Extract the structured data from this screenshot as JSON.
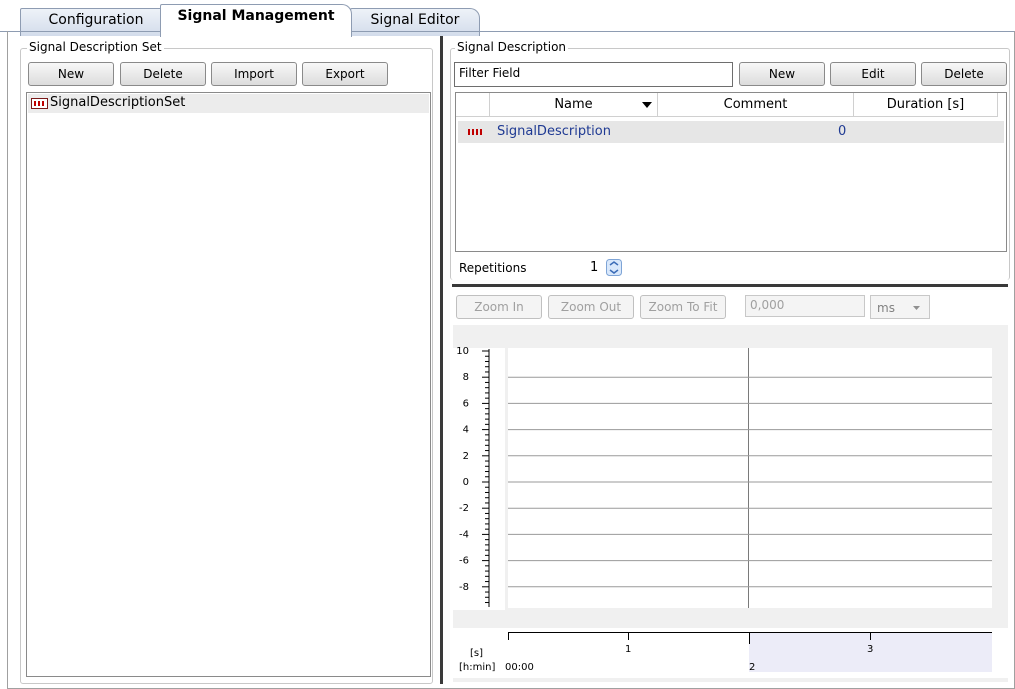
{
  "tabs": [
    {
      "label": "Configuration"
    },
    {
      "label": "Signal Management"
    },
    {
      "label": "Signal Editor"
    }
  ],
  "left_panel": {
    "title": "Signal Description Set",
    "buttons": {
      "new": "New",
      "delete": "Delete",
      "import": "Import",
      "export": "Export"
    },
    "tree": [
      {
        "label": "SignalDescriptionSet"
      }
    ]
  },
  "right_panel": {
    "title": "Signal Description",
    "filter": {
      "value": "Filter Field"
    },
    "buttons": {
      "new": "New",
      "edit": "Edit",
      "delete": "Delete"
    },
    "table": {
      "columns": [
        "Name",
        "Comment",
        "Duration [s]"
      ],
      "rows": [
        {
          "name": "SignalDescription",
          "comment": "",
          "duration": "0"
        }
      ]
    },
    "repetitions": {
      "label": "Repetitions",
      "value": "1"
    }
  },
  "editor": {
    "zoom_in": "Zoom In",
    "zoom_out": "Zoom Out",
    "zoom_to_fit": "Zoom To Fit",
    "position_value": "0,000",
    "unit": "ms",
    "y_ticks": [
      "10",
      "8",
      "6",
      "4",
      "2",
      "0",
      "-2",
      "-4",
      "-6",
      "-8"
    ],
    "x_unit_label": "[s]",
    "time_label": "[h:min]",
    "time_value": "00:00",
    "x_ticks": [
      "1",
      "3"
    ],
    "x_sub_tick": "2",
    "colors": {
      "selection_band": "#ececf8",
      "text_link": "#1f3a93",
      "marker": "#c00000"
    }
  }
}
